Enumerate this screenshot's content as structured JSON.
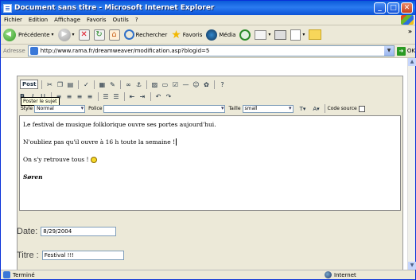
{
  "window": {
    "title": "Document sans titre - Microsoft Internet Explorer",
    "min": "_",
    "max": "□",
    "close": "✕"
  },
  "menu": [
    "Fichier",
    "Edition",
    "Affichage",
    "Favoris",
    "Outils",
    "?"
  ],
  "toolbar": {
    "back_label": "Précédente",
    "search_label": "Rechercher",
    "favorites_label": "Favoris",
    "media_label": "Média"
  },
  "address": {
    "label": "Adresse",
    "url": "http://www.rama.fr/dreamweaver/modification.asp?blogid=5",
    "go_label": "OK"
  },
  "editor": {
    "post_label": "Post",
    "tooltip": "Poster le sujet",
    "style_label": "Style",
    "style_value": "Normal",
    "font_label": "Police",
    "font_value": "",
    "size_label": "Taille",
    "size_value": "small",
    "source_label": "Code source",
    "content": {
      "line1": "Le festival de musique folklorique ouvre ses portes aujourd'hui.",
      "line2": "N'oubliez pas qu'il ouvre à 16 h toute la semaine !",
      "line3": "On s'y retrouve tous !",
      "signature": "Søren"
    }
  },
  "form": {
    "date_label": "Date:",
    "date_value": "8/29/2004",
    "title_label": "Titre :",
    "title_value": "Festival !!!"
  },
  "status": {
    "text": "Terminé",
    "zone": "Internet"
  }
}
